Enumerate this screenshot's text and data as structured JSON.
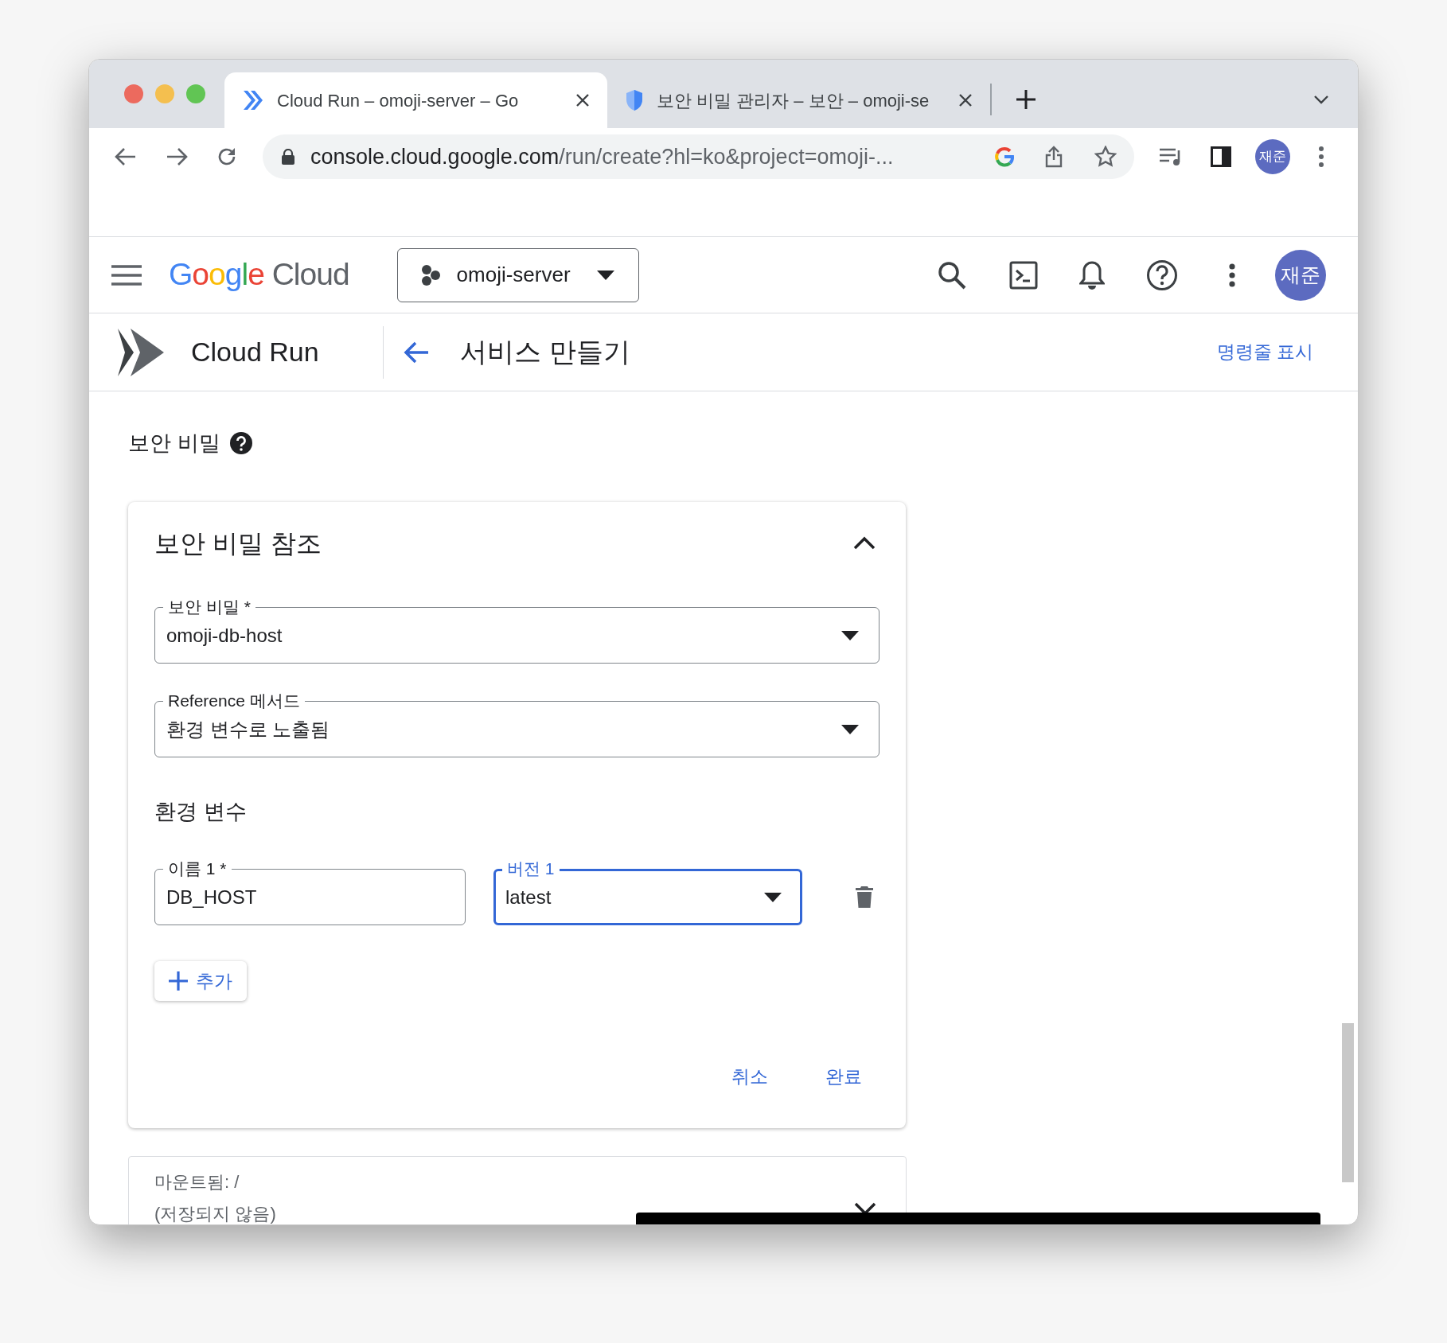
{
  "browser": {
    "tabs": [
      {
        "title": "Cloud Run – omoji-server – Go",
        "kind": "cloud-run",
        "selected": true
      },
      {
        "title": "보안 비밀 관리자 – 보안 – omoji-se",
        "kind": "shield",
        "selected": false
      }
    ],
    "url_host": "console.cloud.google.com",
    "url_path": "/run/create?hl=ko&project=omoji-...",
    "profile": "재준"
  },
  "console_header": {
    "logo_brand": "Google",
    "logo_product": "Cloud",
    "project": "omoji-server",
    "avatar": "재준"
  },
  "page_header": {
    "product": "Cloud Run",
    "title": "서비스 만들기",
    "link": "명령줄 표시"
  },
  "section": {
    "title": "보안 비밀",
    "card": {
      "title": "보안 비밀 참조",
      "expanded": true,
      "fields": [
        {
          "label": "보안 비밀 *",
          "value": "omoji-db-host",
          "focused": false
        },
        {
          "label": "Reference 메서드",
          "value": "환경 변수로 노출됨",
          "focused": false
        }
      ],
      "env_title": "환경 변수",
      "env_rows": [
        {
          "name_label": "이름 1 *",
          "name_value": "DB_HOST",
          "name_focused": false,
          "version_label": "버전 1",
          "version_value": "latest",
          "version_focused": true
        }
      ],
      "add_button": "추가",
      "actions": [
        "취소",
        "완료"
      ]
    },
    "collapsed_card": {
      "lines": [
        "마운트됨: /",
        "(저장되지 않음)"
      ],
      "expanded": false
    }
  }
}
